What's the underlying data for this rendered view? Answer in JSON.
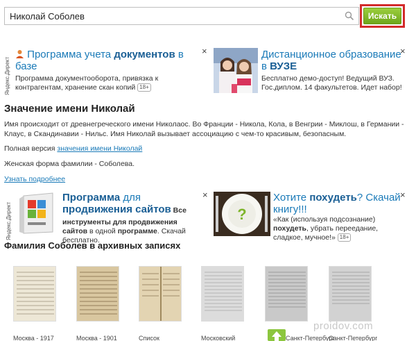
{
  "search": {
    "value": "Николай Соболев",
    "button_label": "Искать"
  },
  "ad_label": "Яндекс.Директ",
  "ad1": {
    "close": "×",
    "title_part1": "Программа учета ",
    "title_bold": "документов",
    "title_part2": " в базе",
    "text": "Программа документооборота, привязка к контрагентам, хранение скан копий",
    "age": "18+"
  },
  "ad2": {
    "close": "×",
    "title_part1": "Дистанционное образование в ",
    "title_bold": "ВУЗЕ",
    "text": "Бесплатно демо-доступ! Ведущий ВУЗ. Гос.диплом. 14 факультетов. Идет набор!"
  },
  "meaning": {
    "heading": "Значение имени Николай",
    "text": "Имя происходит от древнегреческого имени Николаос. Во Франции - Никола, Кола, в Венгрии - Миклош, в Германии - Клаус, в Скандинавии - Нильс. Имя Николай вызывает ассоциацию с чем-то красивым, безопасным.",
    "full_prefix": "Полная версия ",
    "full_link": "значения имени Николай",
    "female_form": "Женская форма фамилии - Соболева.",
    "more_link": "Узнать подробнее"
  },
  "ad3": {
    "close": "×",
    "title_part1": "Программа",
    "title_part2": " для ",
    "title_part3": "продвижения сайтов",
    "text1": " Все инструменты для продвижения ",
    "text_bold": "сайтов",
    "text2": " в одной ",
    "text_bold2": "программе",
    "text3": ". Скачай бесплатно."
  },
  "ad4": {
    "close": "×",
    "title_part1": "Хотите ",
    "title_bold": "похудеть",
    "title_part2": "? Скачай книгу!!!",
    "text1": " «Как (используя подсознание) ",
    "text_bold": "похудеть",
    "text2": ", убрать переедание, сладкое, мучное!»",
    "age": "18+"
  },
  "archive": {
    "heading": "Фамилия Соболев в архивных записях",
    "captions": [
      "Москва - 1917",
      "Москва - 1901",
      "Список",
      "Московский",
      "Санкт-Петербург",
      "Санкт-Петербург"
    ]
  },
  "watermark": "proidov.com",
  "colors": {
    "link": "#1a7ab8",
    "button_green": "#7cb428",
    "highlight_red": "#d32b2b"
  }
}
